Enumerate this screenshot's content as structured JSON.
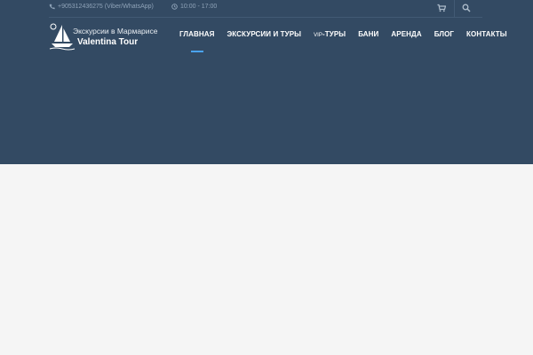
{
  "topbar": {
    "phone": "+905312436275 (Viber/WhatsApp)",
    "hours": "10:00 - 17:00",
    "phone_icon": "phone-icon",
    "clock_icon": "clock-icon",
    "cart_icon": "cart-icon",
    "search_icon": "search-icon"
  },
  "logo": {
    "line1": "Экскурсии в Мармарисе",
    "line2": "Valentina Tour",
    "icon": "sailboat-icon"
  },
  "nav": {
    "items": [
      {
        "label": "ГЛАВНАЯ",
        "active": true
      },
      {
        "label": "ЭКСКУРСИИ И ТУРЫ"
      },
      {
        "prefix": "VIP",
        "label": "-ТУРЫ"
      },
      {
        "label": "БАНИ"
      },
      {
        "label": "АРЕНДА"
      },
      {
        "label": "БЛОГ"
      },
      {
        "label": "КОНТАКТЫ"
      }
    ]
  },
  "colors": {
    "hero_bg": "#334a63",
    "page_bg": "#f5f5f5",
    "accent": "#4aa3f0"
  }
}
